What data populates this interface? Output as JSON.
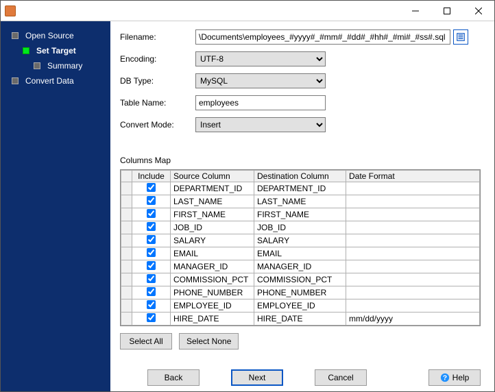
{
  "sidebar": {
    "items": [
      {
        "label": "Open Source"
      },
      {
        "label": "Set Target"
      },
      {
        "label": "Summary"
      },
      {
        "label": "Convert Data"
      }
    ]
  },
  "form": {
    "filename_label": "Filename:",
    "filename_value": "\\Documents\\employees_#yyyy#_#mm#_#dd#_#hh#_#mi#_#ss#.sql",
    "encoding_label": "Encoding:",
    "encoding_value": "UTF-8",
    "dbtype_label": "DB Type:",
    "dbtype_value": "MySQL",
    "tablename_label": "Table Name:",
    "tablename_value": "employees",
    "convertmode_label": "Convert Mode:",
    "convertmode_value": "Insert"
  },
  "columns_map": {
    "title": "Columns Map",
    "headers": {
      "include": "Include",
      "source": "Source Column",
      "destination": "Destination Column",
      "date_format": "Date Format"
    },
    "rows": [
      {
        "include": true,
        "source": "DEPARTMENT_ID",
        "destination": "DEPARTMENT_ID",
        "date_format": ""
      },
      {
        "include": true,
        "source": "LAST_NAME",
        "destination": "LAST_NAME",
        "date_format": ""
      },
      {
        "include": true,
        "source": "FIRST_NAME",
        "destination": "FIRST_NAME",
        "date_format": ""
      },
      {
        "include": true,
        "source": "JOB_ID",
        "destination": "JOB_ID",
        "date_format": ""
      },
      {
        "include": true,
        "source": "SALARY",
        "destination": "SALARY",
        "date_format": ""
      },
      {
        "include": true,
        "source": "EMAIL",
        "destination": "EMAIL",
        "date_format": ""
      },
      {
        "include": true,
        "source": "MANAGER_ID",
        "destination": "MANAGER_ID",
        "date_format": ""
      },
      {
        "include": true,
        "source": "COMMISSION_PCT",
        "destination": "COMMISSION_PCT",
        "date_format": ""
      },
      {
        "include": true,
        "source": "PHONE_NUMBER",
        "destination": "PHONE_NUMBER",
        "date_format": ""
      },
      {
        "include": true,
        "source": "EMPLOYEE_ID",
        "destination": "EMPLOYEE_ID",
        "date_format": ""
      },
      {
        "include": true,
        "source": "HIRE_DATE",
        "destination": "HIRE_DATE",
        "date_format": "mm/dd/yyyy"
      }
    ]
  },
  "buttons": {
    "select_all": "Select All",
    "select_none": "Select None",
    "back": "Back",
    "next": "Next",
    "cancel": "Cancel",
    "help": "Help"
  }
}
